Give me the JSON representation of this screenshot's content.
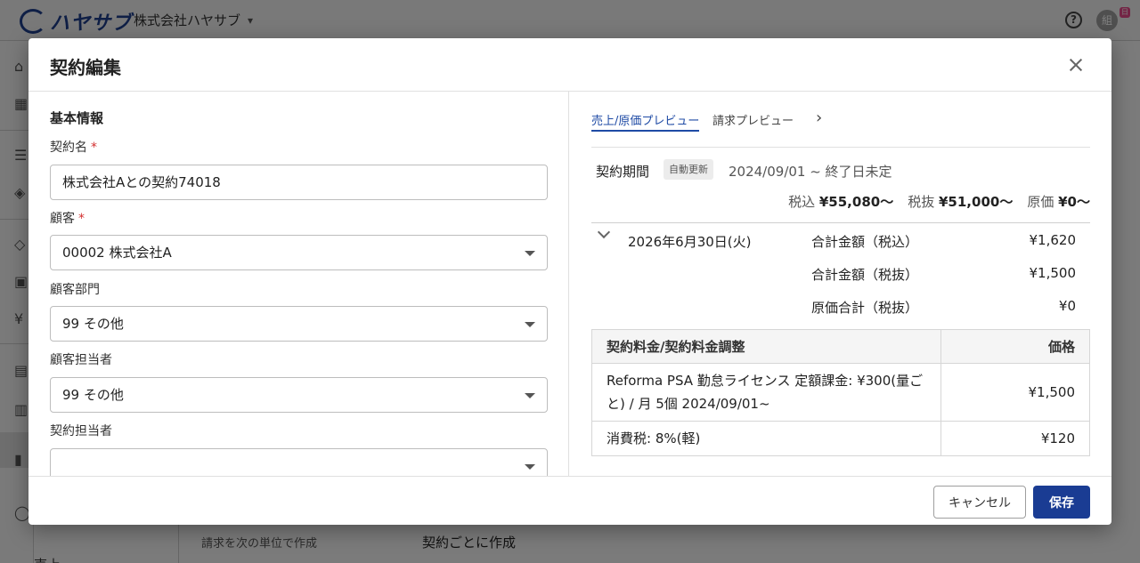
{
  "app": {
    "brand": "ハヤサブ",
    "company": "株式会社ハヤサブ",
    "avatar_initial": "組",
    "avatar_badge": "日",
    "help": "?"
  },
  "background": {
    "billing_unit_label": "請求を次の単位で作成",
    "billing_unit_value": "契約ごとに作成",
    "sidebar_bottom_label": "売上"
  },
  "modal": {
    "title": "契約編集",
    "basic_info_title": "基本情報",
    "fields": {
      "contract_name": {
        "label": "契約名",
        "required": "*",
        "value": "株式会社Aとの契約74018"
      },
      "customer": {
        "label": "顧客",
        "required": "*",
        "value": "00002 株式会社A"
      },
      "customer_dept": {
        "label": "顧客部門",
        "value": "99 その他"
      },
      "customer_contact": {
        "label": "顧客担当者",
        "value": "99 その他"
      },
      "contract_owner": {
        "label": "契約担当者",
        "value": ""
      }
    },
    "preview": {
      "tabs": [
        "売上/原価プレビュー",
        "請求プレビュー"
      ],
      "next_arrow": "›",
      "period_label": "契約期間",
      "auto_renew_badge": "自動更新",
      "period_value": "2024/09/01 ~ 終了日未定",
      "totals": {
        "tax_incl_label": "税込",
        "tax_incl_value": "¥55,080〜",
        "tax_excl_label": "税抜",
        "tax_excl_value": "¥51,000〜",
        "cost_label": "原価",
        "cost_value": "¥0〜"
      },
      "summary": {
        "date": "2026年6月30日(火)",
        "rows": [
          {
            "label": "合計金額（税込）",
            "value": "¥1,620"
          },
          {
            "label": "合計金額（税抜）",
            "value": "¥1,500"
          },
          {
            "label": "原価合計（税抜）",
            "value": "¥0"
          }
        ]
      },
      "table": {
        "headers": [
          "契約料金/契約料金調整",
          "価格"
        ],
        "rows": [
          {
            "item": "Reforma PSA 勤怠ライセンス 定額課金: ¥300(量ごと) / 月 5個 2024/09/01~",
            "price": "¥1,500"
          },
          {
            "item": "消費税: 8%(軽)",
            "price": "¥120"
          }
        ]
      }
    },
    "footer": {
      "cancel": "キャンセル",
      "save": "保存"
    }
  }
}
